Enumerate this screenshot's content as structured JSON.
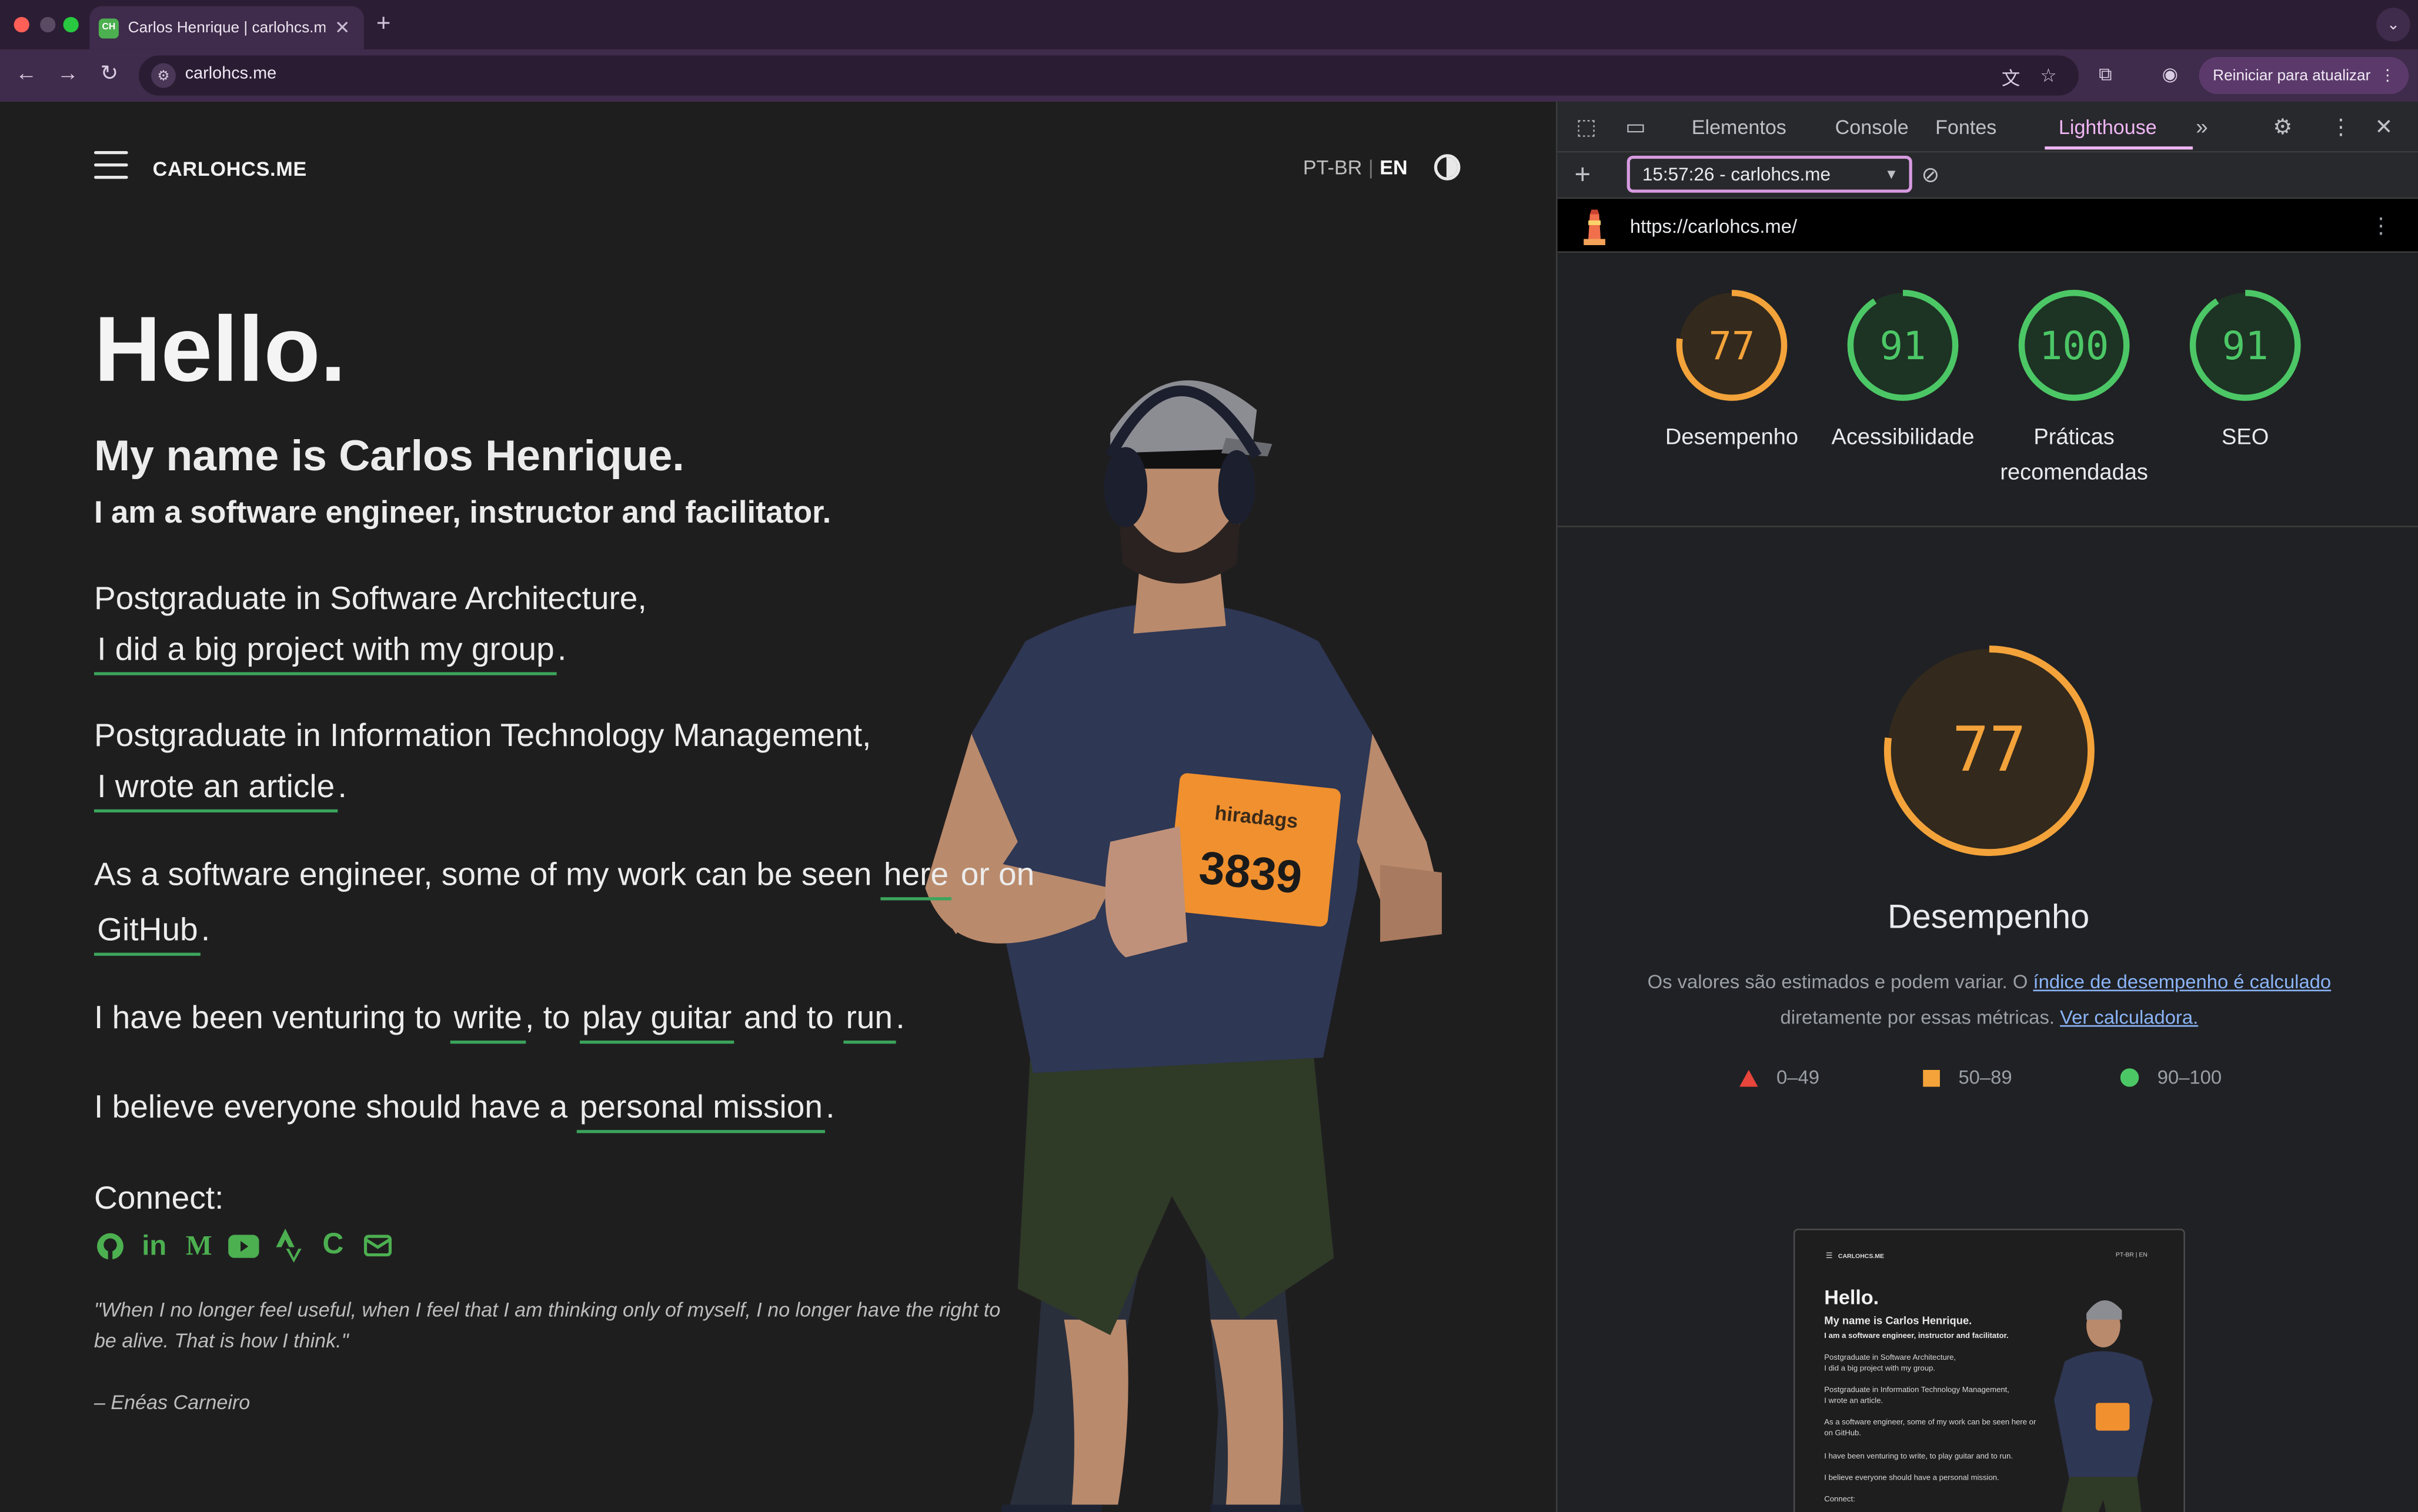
{
  "browser": {
    "tab_title": "Carlos Henrique | carlohcs.me",
    "tab_favicon": "CH",
    "url": "carlohcs.me",
    "update_button": "Reiniciar para atualizar"
  },
  "site": {
    "brand": "CARLOHCS.ME",
    "lang": {
      "pt": "PT-BR",
      "sep": "|",
      "en": "EN"
    },
    "hello": "Hello.",
    "name": "My name is Carlos Henrique.",
    "role": "I am a software engineer, instructor and facilitator.",
    "p1_a": "Postgraduate in Software Architecture,",
    "p1_link": "I did a big project with my group",
    "p1_end": ".",
    "p2_a": "Postgraduate in Information Technology Management,",
    "p2_link": "I wrote an article",
    "p2_end": ".",
    "p3_a": "As a software engineer, some of my work can be seen",
    "p3_link1": "here",
    "p3_b": "or on",
    "p3_link2": "GitHub",
    "p3_end": ".",
    "p4_a": "I have been venturing to",
    "p4_link1": "write",
    "p4_b": ", to",
    "p4_link2": "play guitar",
    "p4_c": "and to",
    "p4_link3": "run",
    "p4_end": ".",
    "p5_a": "I believe everyone should have a",
    "p5_link": "personal mission",
    "p5_end": ".",
    "connect": "Connect:",
    "social_icons": [
      "github-icon",
      "linkedin-icon",
      "medium-icon",
      "youtube-icon",
      "strava-icon",
      "codepen-icon",
      "email-icon"
    ],
    "quote": "\"When I no longer feel useful, when I feel that I am thinking only of myself, I no longer have the right to be alive. That is how I think.\"",
    "author": "– Enéas Carneiro",
    "bib_brand": "hiradags",
    "bib_number": "3839"
  },
  "devtools": {
    "tabs": [
      "Elementos",
      "Console",
      "Fontes",
      "Lighthouse"
    ],
    "active_tab": "Lighthouse",
    "report": "15:57:26 - carlohcs.me",
    "report_url": "https://carlohcs.me/",
    "scores": [
      {
        "value": 77,
        "label": "Desempenho",
        "color": "#f3a33a"
      },
      {
        "value": 91,
        "label": "Acessibilidade",
        "color": "#4cc766"
      },
      {
        "value": 100,
        "label": "Práticas recomendadas",
        "color": "#4cc766"
      },
      {
        "value": 91,
        "label": "SEO",
        "color": "#4cc766"
      }
    ],
    "big_score": 77,
    "big_title": "Desempenho",
    "desc_a": "Os valores são estimados e podem variar. O",
    "desc_link1": "índice de desempenho é calculado",
    "desc_b": "diretamente por essas métricas.",
    "desc_link2": "Ver calculadora.",
    "legend": [
      {
        "range": "0–49",
        "color": "#e8453c"
      },
      {
        "range": "50–89",
        "color": "#f3a33a"
      },
      {
        "range": "90–100",
        "color": "#4cc766"
      }
    ]
  },
  "thumbnail": {
    "brand": "CARLOHCS.ME",
    "lang": "PT-BR | EN",
    "hello": "Hello.",
    "name": "My name is Carlos Henrique.",
    "role": "I am a software engineer, instructor and facilitator.",
    "lines": [
      "Postgraduate in Software Architecture,",
      "I did a big project with my group.",
      "Postgraduate in Information Technology Management,",
      "I wrote an article.",
      "As a software engineer, some of my work can be seen here or",
      "on GitHub.",
      "I have been venturing to write, to play guitar and to run.",
      "I believe everyone should have a personal mission.",
      "Connect:"
    ]
  }
}
